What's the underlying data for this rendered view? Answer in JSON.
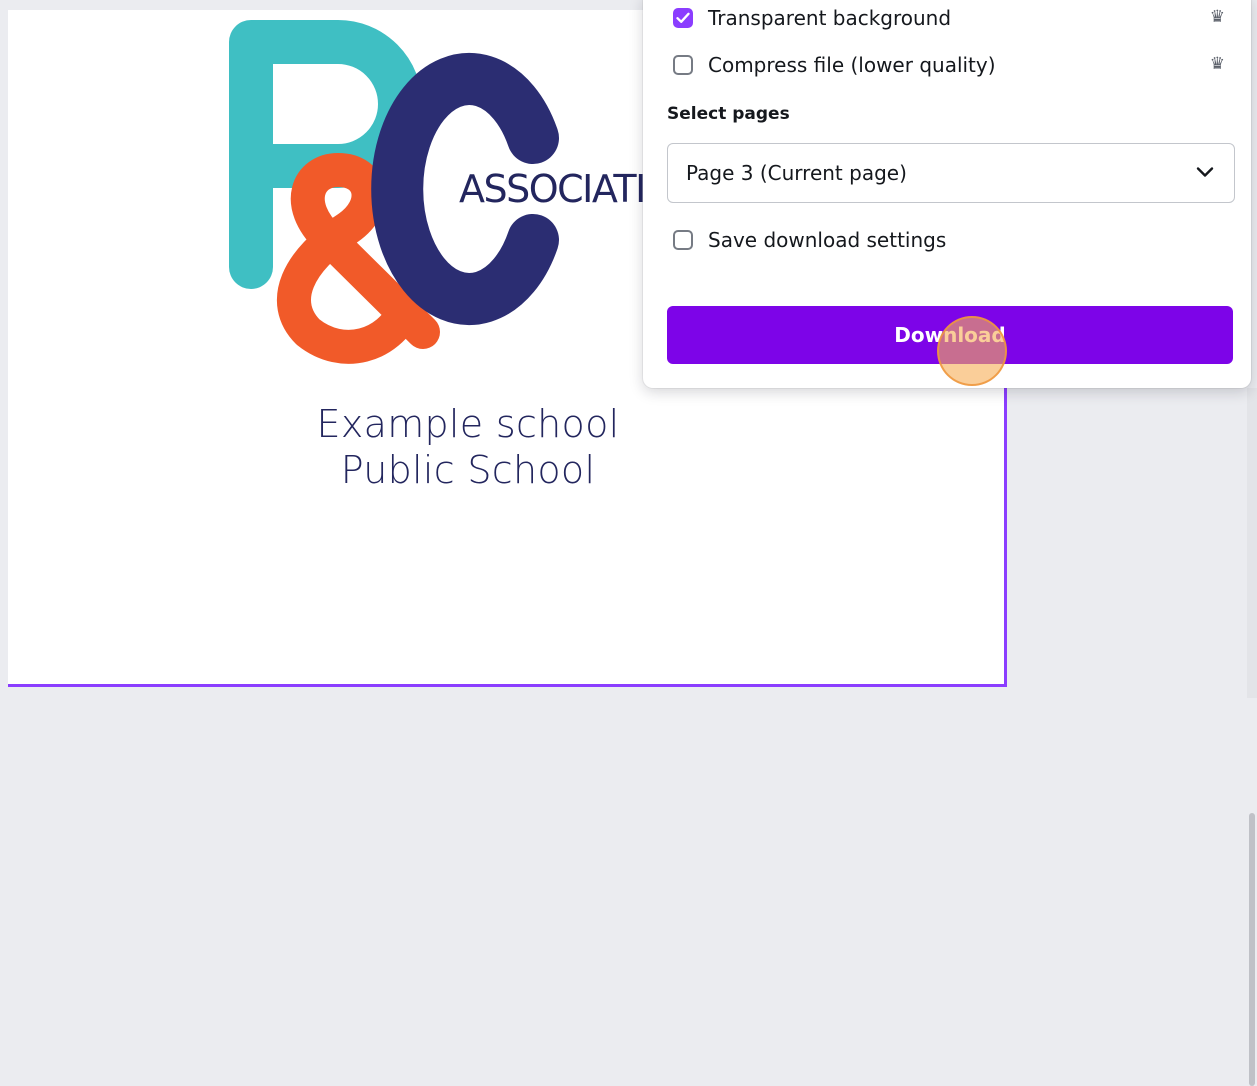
{
  "canvas": {
    "logo": {
      "letters_text": "P&C",
      "wordmark": "ASSOCIATIO",
      "colors": {
        "p": "#3fbfc3",
        "ampersand": "#f15a29",
        "c": "#2b2d72",
        "wordmark": "#23265e"
      }
    },
    "school_name_line1": "Example school",
    "school_name_line2": "Public School",
    "selection_border_color": "#8b3dff"
  },
  "download_panel": {
    "options": [
      {
        "label": "Transparent background",
        "checked": true,
        "premium_icon": "crown-icon"
      },
      {
        "label": "Compress file (lower quality)",
        "checked": false,
        "premium_icon": "crown-icon"
      }
    ],
    "select_pages_label": "Select pages",
    "page_select_value": "Page 3 (Current page)",
    "save_settings_label": "Save download settings",
    "save_settings_checked": false,
    "download_button_label": "Download",
    "accent_color": "#7d04e8",
    "checkbox_checked_color": "#8b3dff"
  },
  "icons": {
    "crown": "crown-icon",
    "chevron": "chevron-down-icon",
    "check": "check-icon"
  }
}
